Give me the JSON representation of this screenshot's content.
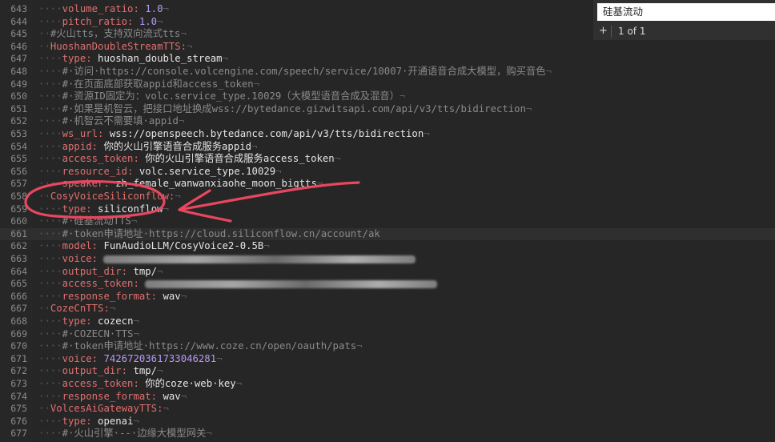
{
  "find": {
    "query": "硅基流动",
    "add_label": "+",
    "match_count": "1 of 1"
  },
  "lines": [
    {
      "n": "643",
      "ind": "····",
      "tokens": [
        {
          "t": "volume_ratio:",
          "c": "key"
        },
        {
          "t": " ",
          "c": "str"
        },
        {
          "t": "1.0",
          "c": "num"
        },
        {
          "t": "¬",
          "c": "ret"
        }
      ]
    },
    {
      "n": "644",
      "ind": "····",
      "tokens": [
        {
          "t": "pitch_ratio:",
          "c": "key"
        },
        {
          "t": " ",
          "c": "str"
        },
        {
          "t": "1.0",
          "c": "num"
        },
        {
          "t": "¬",
          "c": "ret"
        }
      ]
    },
    {
      "n": "645",
      "ind": "··",
      "tokens": [
        {
          "t": "#火山tts，支持双向流式tts",
          "c": "com"
        },
        {
          "t": "¬",
          "c": "ret"
        }
      ]
    },
    {
      "n": "646",
      "ind": "··",
      "tokens": [
        {
          "t": "HuoshanDoubleStreamTTS:",
          "c": "key"
        },
        {
          "t": "¬",
          "c": "ret"
        }
      ]
    },
    {
      "n": "647",
      "ind": "····",
      "tokens": [
        {
          "t": "type:",
          "c": "key"
        },
        {
          "t": " huoshan_double_stream",
          "c": "str"
        },
        {
          "t": "¬",
          "c": "ret"
        }
      ]
    },
    {
      "n": "648",
      "ind": "····",
      "tokens": [
        {
          "t": "#·访问·https://console.volcengine.com/speech/service/10007·开通语音合成大模型，购买音色",
          "c": "com"
        },
        {
          "t": "¬",
          "c": "ret"
        }
      ]
    },
    {
      "n": "649",
      "ind": "····",
      "tokens": [
        {
          "t": "#·在页面底部获取appid和access_token",
          "c": "com"
        },
        {
          "t": "¬",
          "c": "ret"
        }
      ]
    },
    {
      "n": "650",
      "ind": "····",
      "tokens": [
        {
          "t": "#·资源ID固定为：volc.service_type.10029（大模型语音合成及混音）",
          "c": "com"
        },
        {
          "t": "¬",
          "c": "ret"
        }
      ]
    },
    {
      "n": "651",
      "ind": "····",
      "tokens": [
        {
          "t": "#·如果是机智云，把接口地址换成wss://bytedance.gizwitsapi.com/api/v3/tts/bidirection",
          "c": "com"
        },
        {
          "t": "¬",
          "c": "ret"
        }
      ]
    },
    {
      "n": "652",
      "ind": "····",
      "tokens": [
        {
          "t": "#·机智云不需要填·appid",
          "c": "com"
        },
        {
          "t": "¬",
          "c": "ret"
        }
      ]
    },
    {
      "n": "653",
      "ind": "····",
      "tokens": [
        {
          "t": "ws_url:",
          "c": "key"
        },
        {
          "t": " wss://openspeech.bytedance.com/api/v3/tts/bidirection",
          "c": "str"
        },
        {
          "t": "¬",
          "c": "ret"
        }
      ]
    },
    {
      "n": "654",
      "ind": "····",
      "tokens": [
        {
          "t": "appid:",
          "c": "key"
        },
        {
          "t": " 你的火山引擎语音合成服务appid",
          "c": "str"
        },
        {
          "t": "¬",
          "c": "ret"
        }
      ]
    },
    {
      "n": "655",
      "ind": "····",
      "tokens": [
        {
          "t": "access_token:",
          "c": "key"
        },
        {
          "t": " 你的火山引擎语音合成服务access_token",
          "c": "str"
        },
        {
          "t": "¬",
          "c": "ret"
        }
      ]
    },
    {
      "n": "656",
      "ind": "····",
      "tokens": [
        {
          "t": "resource_id:",
          "c": "key"
        },
        {
          "t": " volc.service_type.10029",
          "c": "str"
        },
        {
          "t": "¬",
          "c": "ret"
        }
      ]
    },
    {
      "n": "657",
      "ind": "····",
      "tokens": [
        {
          "t": "speaker:",
          "c": "key"
        },
        {
          "t": " zh_female_wanwanxiaohe_moon_bigtts",
          "c": "str"
        },
        {
          "t": "¬",
          "c": "ret"
        }
      ]
    },
    {
      "n": "658",
      "ind": "··",
      "tokens": [
        {
          "t": "CosyVoiceSiliconflow:",
          "c": "key"
        },
        {
          "t": "¬",
          "c": "ret"
        }
      ]
    },
    {
      "n": "659",
      "ind": "····",
      "tokens": [
        {
          "t": "type:",
          "c": "key"
        },
        {
          "t": " siliconflow",
          "c": "str"
        },
        {
          "t": "¬",
          "c": "ret"
        }
      ]
    },
    {
      "n": "660",
      "ind": "····",
      "tokens": [
        {
          "t": "#·硅基流动TTS",
          "c": "com"
        },
        {
          "t": "¬",
          "c": "ret"
        }
      ]
    },
    {
      "n": "661",
      "ind": "····",
      "current": true,
      "tokens": [
        {
          "t": "#·token申请地址·https://cloud.siliconflow.cn/account/ak",
          "c": "com"
        }
      ]
    },
    {
      "n": "662",
      "ind": "····",
      "tokens": [
        {
          "t": "model:",
          "c": "key"
        },
        {
          "t": " FunAudioLLM/CosyVoice2-0.5B",
          "c": "str"
        },
        {
          "t": "¬",
          "c": "ret"
        }
      ]
    },
    {
      "n": "663",
      "ind": "····",
      "blur": true,
      "tokens": [
        {
          "t": "voice:",
          "c": "key"
        },
        {
          "t": " ",
          "c": "str"
        }
      ]
    },
    {
      "n": "664",
      "ind": "····",
      "tokens": [
        {
          "t": "output_dir:",
          "c": "key"
        },
        {
          "t": " tmp/",
          "c": "str"
        },
        {
          "t": "¬",
          "c": "ret"
        }
      ]
    },
    {
      "n": "665",
      "ind": "····",
      "blur": true,
      "tokens": [
        {
          "t": "access_token:",
          "c": "key"
        },
        {
          "t": " ",
          "c": "str"
        }
      ]
    },
    {
      "n": "666",
      "ind": "····",
      "tokens": [
        {
          "t": "response_format:",
          "c": "key"
        },
        {
          "t": " wav",
          "c": "str"
        },
        {
          "t": "¬",
          "c": "ret"
        }
      ]
    },
    {
      "n": "667",
      "ind": "··",
      "tokens": [
        {
          "t": "CozeCnTTS:",
          "c": "key"
        },
        {
          "t": "¬",
          "c": "ret"
        }
      ]
    },
    {
      "n": "668",
      "ind": "····",
      "tokens": [
        {
          "t": "type:",
          "c": "key"
        },
        {
          "t": " cozecn",
          "c": "str"
        },
        {
          "t": "¬",
          "c": "ret"
        }
      ]
    },
    {
      "n": "669",
      "ind": "····",
      "tokens": [
        {
          "t": "#·COZECN·TTS",
          "c": "com"
        },
        {
          "t": "¬",
          "c": "ret"
        }
      ]
    },
    {
      "n": "670",
      "ind": "····",
      "tokens": [
        {
          "t": "#·token申请地址·https://www.coze.cn/open/oauth/pats",
          "c": "com"
        },
        {
          "t": "¬",
          "c": "ret"
        }
      ]
    },
    {
      "n": "671",
      "ind": "····",
      "tokens": [
        {
          "t": "voice:",
          "c": "key"
        },
        {
          "t": " ",
          "c": "str"
        },
        {
          "t": "7426720361733046281",
          "c": "num"
        },
        {
          "t": "¬",
          "c": "ret"
        }
      ]
    },
    {
      "n": "672",
      "ind": "····",
      "tokens": [
        {
          "t": "output_dir:",
          "c": "key"
        },
        {
          "t": " tmp/",
          "c": "str"
        },
        {
          "t": "¬",
          "c": "ret"
        }
      ]
    },
    {
      "n": "673",
      "ind": "····",
      "tokens": [
        {
          "t": "access_token:",
          "c": "key"
        },
        {
          "t": " 你的coze·web·key",
          "c": "str"
        },
        {
          "t": "¬",
          "c": "ret"
        }
      ]
    },
    {
      "n": "674",
      "ind": "····",
      "tokens": [
        {
          "t": "response_format:",
          "c": "key"
        },
        {
          "t": " wav",
          "c": "str"
        },
        {
          "t": "¬",
          "c": "ret"
        }
      ]
    },
    {
      "n": "675",
      "ind": "··",
      "tokens": [
        {
          "t": "VolcesAiGatewayTTS:",
          "c": "key"
        },
        {
          "t": "¬",
          "c": "ret"
        }
      ]
    },
    {
      "n": "676",
      "ind": "····",
      "tokens": [
        {
          "t": "type:",
          "c": "key"
        },
        {
          "t": " openai",
          "c": "str"
        },
        {
          "t": "¬",
          "c": "ret"
        }
      ]
    },
    {
      "n": "677",
      "ind": "····",
      "tokens": [
        {
          "t": "#·火山引擎·--·边缘大模型网关",
          "c": "com"
        },
        {
          "t": "¬",
          "c": "ret"
        }
      ]
    }
  ],
  "colors": {
    "background": "#262626",
    "key": "#e16f6f",
    "number": "#b79af5",
    "comment": "#8a8a8a",
    "annotation": "#e8475e"
  }
}
